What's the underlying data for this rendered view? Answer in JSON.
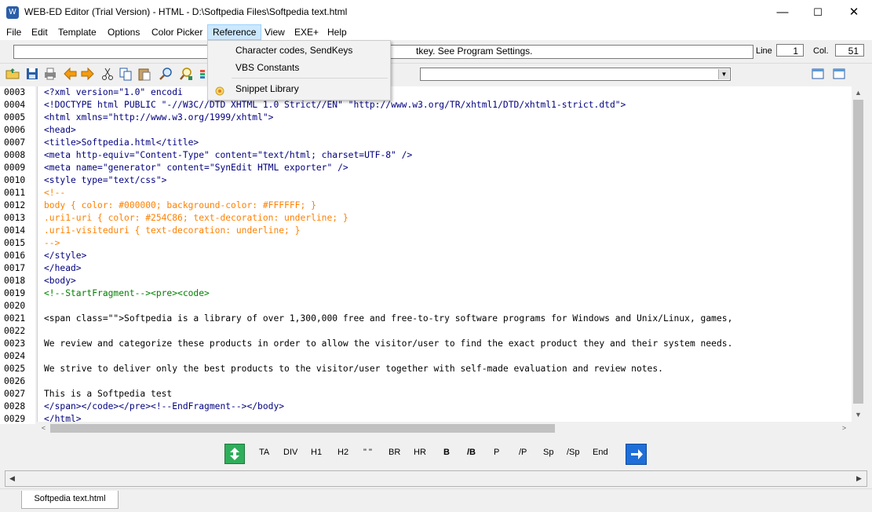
{
  "window": {
    "title": "WEB-ED Editor (Trial Version) - HTML - D:\\Softpedia Files\\Softpedia text.html",
    "minimize": "—",
    "maximize": "☐",
    "close": "✕"
  },
  "menu": [
    "File",
    "Edit",
    "Template",
    "Options",
    "Color Picker",
    "Reference",
    "View",
    "EXE+",
    "Help"
  ],
  "reference_menu": {
    "items": [
      "Character codes, SendKeys",
      "VBS Constants",
      "Snippet Library"
    ]
  },
  "info": {
    "hint": "tkey. See Program Settings.",
    "line_label": "Line",
    "line_value": "1",
    "col_label": "Col.",
    "col_value": "51"
  },
  "toolbar_icons": [
    "open-folder-icon",
    "save-icon",
    "print-icon",
    "back-arrow-icon",
    "forward-arrow-icon",
    "cut-icon",
    "copy-icon",
    "paste-icon",
    "find-icon",
    "find-replace-icon"
  ],
  "editor": {
    "line_numbers": [
      "0003",
      "0004",
      "0005",
      "0006",
      "0007",
      "0008",
      "0009",
      "0010",
      "0011",
      "0012",
      "0013",
      "0014",
      "0015",
      "0016",
      "0017",
      "0018",
      "0019",
      "0020",
      "0021",
      "0022",
      "0023",
      "0024",
      "0025",
      "0026",
      "0027",
      "0028",
      "0029"
    ],
    "lines": [
      "<?xml version=\"1.0\" encodi",
      "<!DOCTYPE html PUBLIC \"-//W3C//DTD XHTML 1.0 Strict//EN\" \"http://www.w3.org/TR/xhtml1/DTD/xhtml1-strict.dtd\">",
      "<html xmlns=\"http://www.w3.org/1999/xhtml\">",
      "<head>",
      "<title>Softpedia.html</title>",
      "<meta http-equiv=\"Content-Type\" content=\"text/html; charset=UTF-8\" />",
      "<meta name=\"generator\" content=\"SynEdit HTML exporter\" />",
      "<style type=\"text/css\">",
      "<!--",
      "body { color: #000000; background-color: #FFFFFF; }",
      ".uri1-uri { color: #254C86; text-decoration: underline; }",
      ".uri1-visiteduri { text-decoration: underline; }",
      "-->",
      "</style>",
      "</head>",
      "<body>",
      "<!--StartFragment--><pre><code>",
      "",
      "<span class=\"\">Softpedia is a library of over 1,300,000 free and free-to-try software programs for Windows and Unix/Linux, games,",
      "",
      "We review and categorize these products in order to allow the visitor/user to find the exact product they and their system needs.",
      "",
      "We strive to deliver only the best products to the visitor/user together with self-made evaluation and review notes.",
      "",
      "This is a Softpedia test",
      "</span></code></pre><!--EndFragment--></body>",
      "</html>"
    ]
  },
  "tag_buttons": [
    "TA",
    "DIV",
    "H1",
    "H2",
    "\" \"",
    "BR",
    "HR",
    "B",
    "/B",
    "P",
    "/P",
    "Sp",
    "/Sp",
    "End"
  ],
  "document_tab": "Softpedia text.html",
  "colors": {
    "tag": "#000080",
    "attribute_value": "#0000ff",
    "comment": "#008000",
    "menu_highlight": "#cce8ff"
  }
}
